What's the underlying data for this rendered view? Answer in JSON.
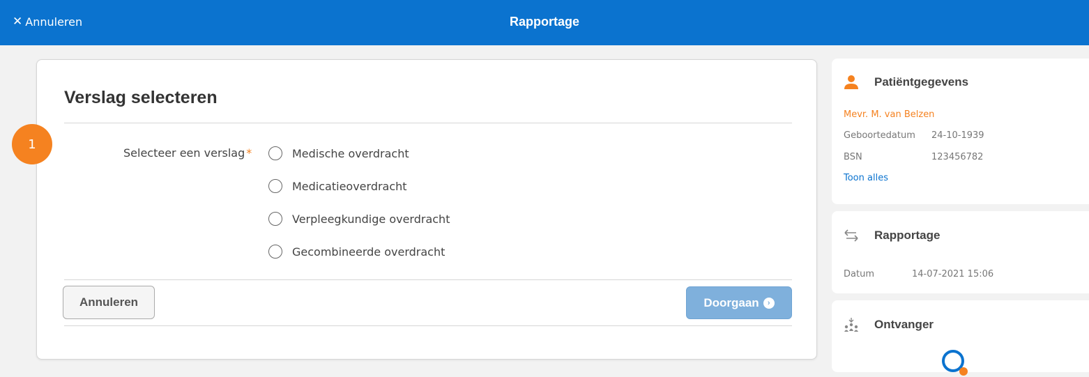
{
  "topbar": {
    "cancel_label": "Annuleren",
    "title": "Rapportage",
    "bg_color": "#0b73cf"
  },
  "form": {
    "title": "Verslag selecteren",
    "step_number": "1",
    "field_label": "Selecteer een verslag",
    "required_mark": "*",
    "options": [
      "Medische overdracht",
      "Medicatieoverdracht",
      "Verpleegkundige overdracht",
      "Gecombineerde overdracht"
    ],
    "cancel_button": "Annuleren",
    "continue_button": "Doorgaan"
  },
  "patient": {
    "heading": "Patiëntgegevens",
    "name": "Mevr. M. van Belzen",
    "birth_label": "Geboortedatum",
    "birth_value": "24-10-1939",
    "bsn_label": "BSN",
    "bsn_value": "123456782",
    "show_all": "Toon alles"
  },
  "report": {
    "heading": "Rapportage",
    "date_label": "Datum",
    "date_value": "14-07-2021 15:06"
  },
  "recipient": {
    "heading": "Ontvanger"
  },
  "colors": {
    "accent_orange": "#f58220",
    "disabled_button": "#7fb0dc"
  }
}
